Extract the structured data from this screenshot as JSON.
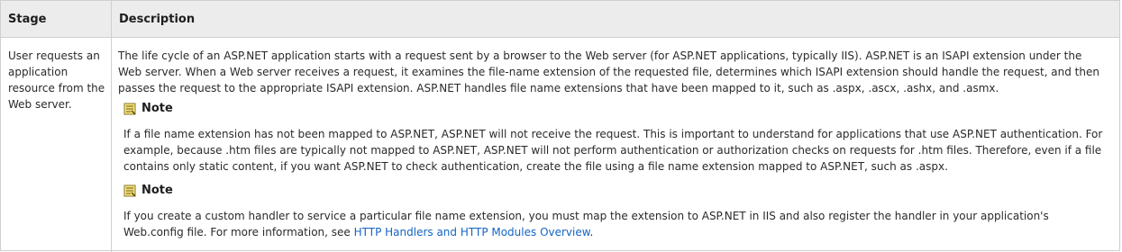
{
  "table": {
    "headers": {
      "stage": "Stage",
      "description": "Description"
    },
    "rows": [
      {
        "stage": "User requests an application resource from the Web server.",
        "description": "The life cycle of an ASP.NET application starts with a request sent by a browser to the Web server (for ASP.NET applications, typically IIS). ASP.NET is an ISAPI extension under the Web server. When a Web server receives a request, it examines the file-name extension of the requested file, determines which ISAPI extension should handle the request, and then passes the request to the appropriate ISAPI extension. ASP.NET handles file name extensions that have been mapped to it, such as .aspx, .ascx, .ashx, and .asmx.",
        "notes": [
          {
            "icon": "note-icon",
            "title": "Note",
            "text": "If a file name extension has not been mapped to ASP.NET, ASP.NET will not receive the request. This is important to understand for applications that use ASP.NET authentication. For example, because .htm files are typically not mapped to ASP.NET, ASP.NET will not perform authentication or authorization checks on requests for .htm files. Therefore, even if a file contains only static content, if you want ASP.NET to check authentication, create the file using a file name extension mapped to ASP.NET, such as .aspx."
          },
          {
            "icon": "note-icon",
            "title": "Note",
            "text_before_link": "If you create a custom handler to service a particular file name extension, you must map the extension to ASP.NET in IIS and also register the handler in your application's Web.config file. For more information, see ",
            "link_text": "HTTP Handlers and HTTP Modules Overview",
            "text_after_link": "."
          }
        ]
      }
    ]
  },
  "colors": {
    "header_background": "#ececec",
    "border": "#cfcfcf",
    "link": "#1364c4"
  }
}
